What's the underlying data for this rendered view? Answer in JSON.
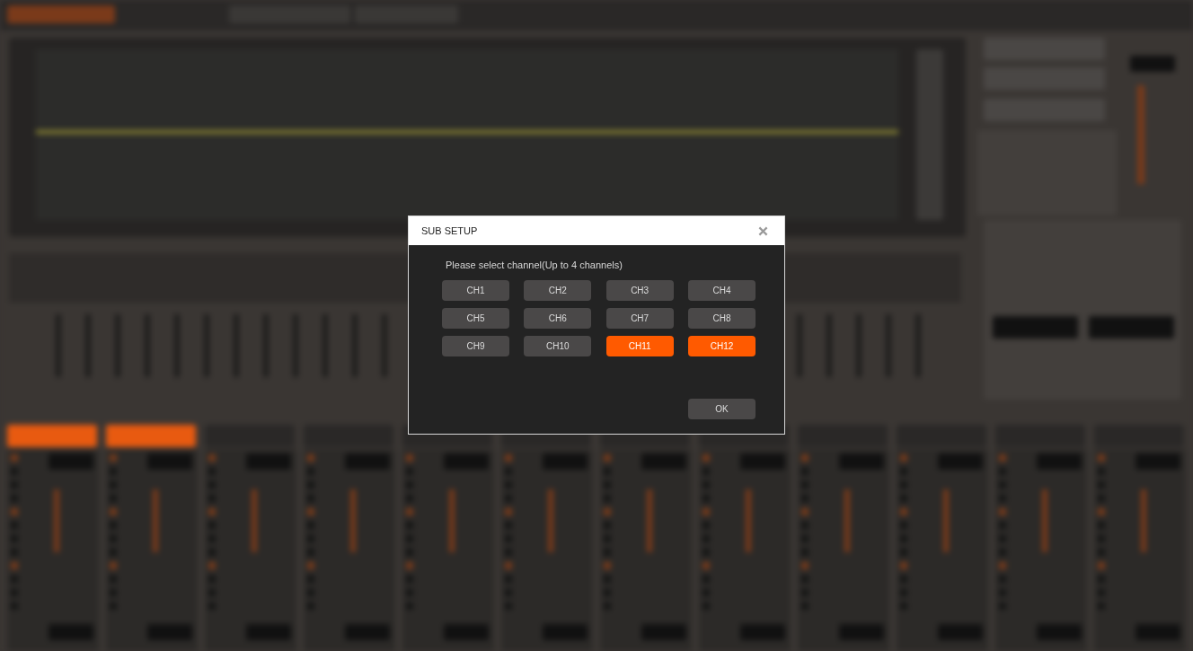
{
  "dialog": {
    "title": "SUB SETUP",
    "prompt": "Please select channel(Up to 4 channels)",
    "channels": [
      {
        "label": "CH1",
        "selected": false
      },
      {
        "label": "CH2",
        "selected": false
      },
      {
        "label": "CH3",
        "selected": false
      },
      {
        "label": "CH4",
        "selected": false
      },
      {
        "label": "CH5",
        "selected": false
      },
      {
        "label": "CH6",
        "selected": false
      },
      {
        "label": "CH7",
        "selected": false
      },
      {
        "label": "CH8",
        "selected": false
      },
      {
        "label": "CH9",
        "selected": false
      },
      {
        "label": "CH10",
        "selected": false
      },
      {
        "label": "CH11",
        "selected": true
      },
      {
        "label": "CH12",
        "selected": true
      }
    ],
    "ok": "OK"
  }
}
